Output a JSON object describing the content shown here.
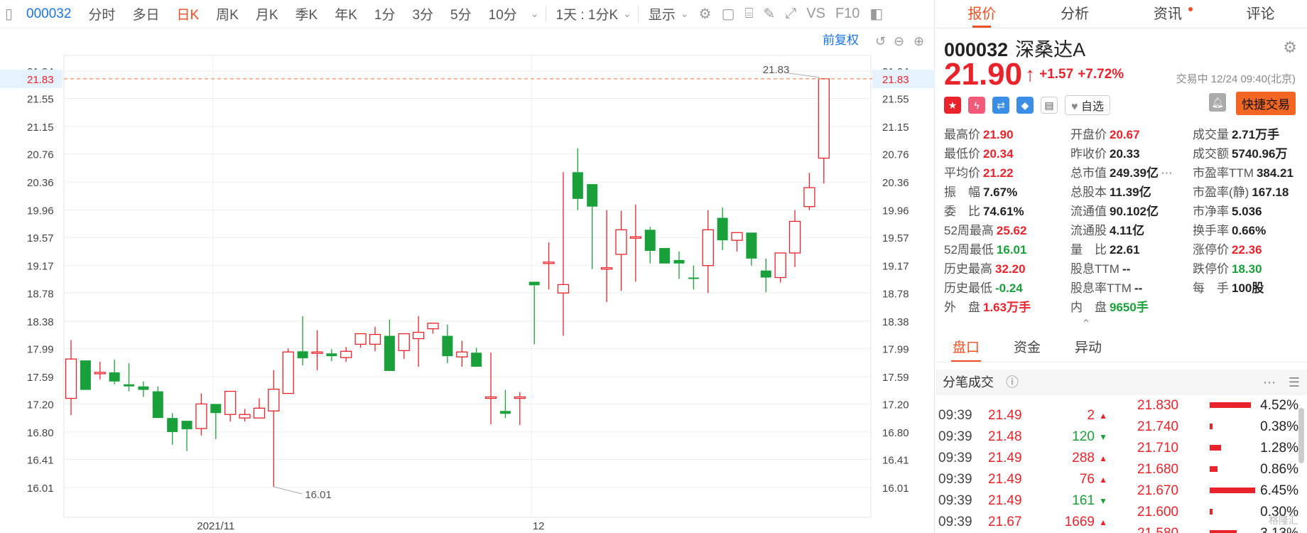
{
  "toolbar": {
    "code": "000032",
    "items": [
      "分时",
      "多日",
      "日K",
      "周K",
      "月K",
      "季K",
      "年K",
      "1分",
      "3分",
      "5分",
      "10分"
    ],
    "active": 2,
    "period_select": "1天 : 1分K",
    "display_label": "显示"
  },
  "chart": {
    "fq_label": "前复权",
    "current_price_label": "21.83",
    "high_label": "21.83",
    "low_label": "16.01",
    "y_ticks": [
      "21.94",
      "21.55",
      "21.15",
      "20.76",
      "20.36",
      "19.96",
      "19.57",
      "19.17",
      "18.78",
      "18.38",
      "17.99",
      "17.59",
      "17.20",
      "16.80",
      "16.41",
      "16.01"
    ],
    "x_labels": [
      {
        "text": "2021/11",
        "index": 10
      },
      {
        "text": "12",
        "index": 32
      }
    ]
  },
  "chart_data": {
    "type": "candlestick",
    "ylim": [
      16.01,
      21.94
    ],
    "open": [
      17.28,
      17.82,
      17.65,
      17.65,
      17.48,
      17.45,
      17.38,
      17.0,
      16.96,
      16.85,
      17.2,
      17.05,
      17.0,
      17.0,
      17.1,
      17.35,
      17.95,
      17.92,
      17.92,
      17.86,
      18.05,
      18.05,
      18.17,
      17.96,
      18.13,
      18.27,
      18.17,
      17.87,
      17.93,
      17.3,
      17.1,
      17.3,
      18.94,
      19.22,
      18.78,
      20.5,
      20.33,
      19.14,
      19.33,
      19.58,
      19.68,
      19.42,
      19.25,
      19.0,
      19.17,
      19.85,
      19.53,
      19.64,
      19.1,
      19.0,
      19.35,
      20.01
    ],
    "close": [
      17.84,
      17.4,
      17.65,
      17.52,
      17.45,
      17.4,
      17.0,
      16.8,
      16.84,
      17.2,
      17.07,
      17.38,
      17.05,
      17.14,
      17.41,
      17.94,
      17.85,
      17.94,
      17.88,
      17.95,
      18.2,
      18.19,
      17.67,
      18.2,
      18.22,
      18.35,
      17.88,
      17.94,
      17.73,
      17.3,
      17.06,
      17.3,
      18.89,
      19.22,
      18.9,
      20.12,
      20.01,
      19.14,
      19.68,
      19.58,
      19.38,
      19.2,
      19.2,
      18.99,
      19.68,
      19.53,
      19.64,
      19.27,
      19.0,
      19.35,
      19.8,
      20.28
    ],
    "high": [
      18.11,
      17.82,
      17.8,
      17.83,
      17.78,
      17.52,
      17.45,
      17.07,
      16.96,
      17.35,
      17.2,
      17.38,
      17.13,
      17.28,
      17.68,
      17.99,
      18.45,
      18.25,
      17.98,
      18.01,
      18.2,
      18.3,
      18.4,
      18.2,
      18.45,
      18.35,
      18.33,
      18.1,
      18.0,
      17.93,
      17.4,
      17.37,
      18.94,
      19.5,
      20.5,
      20.84,
      20.33,
      19.96,
      19.95,
      20.04,
      19.72,
      19.42,
      19.37,
      19.17,
      19.96,
      20.0,
      19.64,
      19.64,
      19.27,
      19.29,
      19.96,
      20.49
    ],
    "low": [
      17.04,
      17.4,
      17.55,
      17.48,
      17.38,
      17.3,
      17.0,
      16.62,
      16.53,
      16.75,
      16.7,
      16.95,
      16.95,
      17.06,
      16.02,
      17.6,
      17.75,
      17.68,
      17.81,
      17.8,
      18.0,
      17.95,
      17.67,
      17.84,
      17.73,
      18.2,
      17.78,
      17.73,
      17.73,
      16.91,
      17.0,
      16.9,
      18.05,
      18.83,
      18.17,
      19.96,
      19.12,
      18.65,
      18.81,
      18.94,
      19.2,
      19.2,
      18.98,
      18.83,
      18.78,
      19.39,
      19.37,
      19.17,
      18.79,
      18.93,
      19.15,
      19.96
    ],
    "last_open": 20.7,
    "last_close": 21.83,
    "last_high": 21.83,
    "last_low": 20.34
  },
  "panel": {
    "tabs": [
      "报价",
      "分析",
      "资讯",
      "评论"
    ],
    "code": "000032",
    "name": "深桑达A",
    "price": "21.90",
    "change": "+1.57",
    "change_pct": "+7.72%",
    "status": "交易中 12/24 09:40(北京)",
    "fav_label": "自选",
    "trade_label": "快捷交易",
    "stats": [
      {
        "label": "最高价",
        "value": "21.90",
        "color": "red"
      },
      {
        "label": "开盘价",
        "value": "20.67",
        "color": "red"
      },
      {
        "label": "成交量",
        "value": "2.71万手",
        "color": "blk"
      },
      {
        "label": "最低价",
        "value": "20.34",
        "color": "red"
      },
      {
        "label": "昨收价",
        "value": "20.33",
        "color": "blk"
      },
      {
        "label": "成交额",
        "value": "5740.96万",
        "color": "blk"
      },
      {
        "label": "平均价",
        "value": "21.22",
        "color": "red"
      },
      {
        "label": "总市值",
        "value": "249.39亿",
        "color": "blk"
      },
      {
        "label": "市盈率TTM",
        "value": "384.21",
        "color": "blk"
      },
      {
        "label": "振　幅",
        "value": "7.67%",
        "color": "blk"
      },
      {
        "label": "总股本",
        "value": "11.39亿",
        "color": "blk"
      },
      {
        "label": "市盈率(静)",
        "value": "167.18",
        "color": "blk"
      },
      {
        "label": "委　比",
        "value": "74.61%",
        "color": "blk"
      },
      {
        "label": "流通值",
        "value": "90.102亿",
        "color": "blk"
      },
      {
        "label": "市净率",
        "value": "5.036",
        "color": "blk"
      },
      {
        "label": "52周最高",
        "value": "25.62",
        "color": "red"
      },
      {
        "label": "流通股",
        "value": "4.11亿",
        "color": "blk"
      },
      {
        "label": "换手率",
        "value": "0.66%",
        "color": "blk"
      },
      {
        "label": "52周最低",
        "value": "16.01",
        "color": "green"
      },
      {
        "label": "量　比",
        "value": "22.61",
        "color": "blk"
      },
      {
        "label": "涨停价",
        "value": "22.36",
        "color": "red"
      },
      {
        "label": "历史最高",
        "value": "32.20",
        "color": "red"
      },
      {
        "label": "股息TTM",
        "value": "--",
        "color": "blk"
      },
      {
        "label": "跌停价",
        "value": "18.30",
        "color": "green"
      },
      {
        "label": "历史最低",
        "value": "-0.24",
        "color": "green"
      },
      {
        "label": "股息率TTM",
        "value": "--",
        "color": "blk"
      },
      {
        "label": "每　手",
        "value": "100股",
        "color": "blk"
      },
      {
        "label": "外　盘",
        "value": "1.63万手",
        "color": "red"
      },
      {
        "label": "内　盘",
        "value": "9650手",
        "color": "green"
      },
      {
        "label": "",
        "value": "",
        "color": "blk"
      }
    ],
    "sub_tabs": [
      "盘口",
      "资金",
      "异动"
    ],
    "ticks_title": "分笔成交",
    "ticks": [
      {
        "time": "09:39",
        "price": "21.49",
        "qty": "2",
        "dir": "up"
      },
      {
        "time": "09:39",
        "price": "21.48",
        "qty": "120",
        "dir": "down"
      },
      {
        "time": "09:39",
        "price": "21.49",
        "qty": "288",
        "dir": "up"
      },
      {
        "time": "09:39",
        "price": "21.49",
        "qty": "76",
        "dir": "up"
      },
      {
        "time": "09:39",
        "price": "21.49",
        "qty": "161",
        "dir": "down"
      },
      {
        "time": "09:39",
        "price": "21.67",
        "qty": "1669",
        "dir": "up"
      }
    ],
    "dist": [
      {
        "price": "21.830",
        "pct": "4.52%",
        "frac": 0.9
      },
      {
        "price": "21.740",
        "pct": "0.38%",
        "frac": 0.07
      },
      {
        "price": "21.710",
        "pct": "1.28%",
        "frac": 0.25
      },
      {
        "price": "21.680",
        "pct": "0.86%",
        "frac": 0.17
      },
      {
        "price": "21.670",
        "pct": "6.45%",
        "frac": 1.0
      },
      {
        "price": "21.600",
        "pct": "0.30%",
        "frac": 0.06
      },
      {
        "price": "21.580",
        "pct": "3.13%",
        "frac": 0.6
      }
    ],
    "watermark": "格隆汇"
  },
  "colors": {
    "up": "#e8232c",
    "down": "#1aa03a",
    "accent": "#f04e23"
  }
}
